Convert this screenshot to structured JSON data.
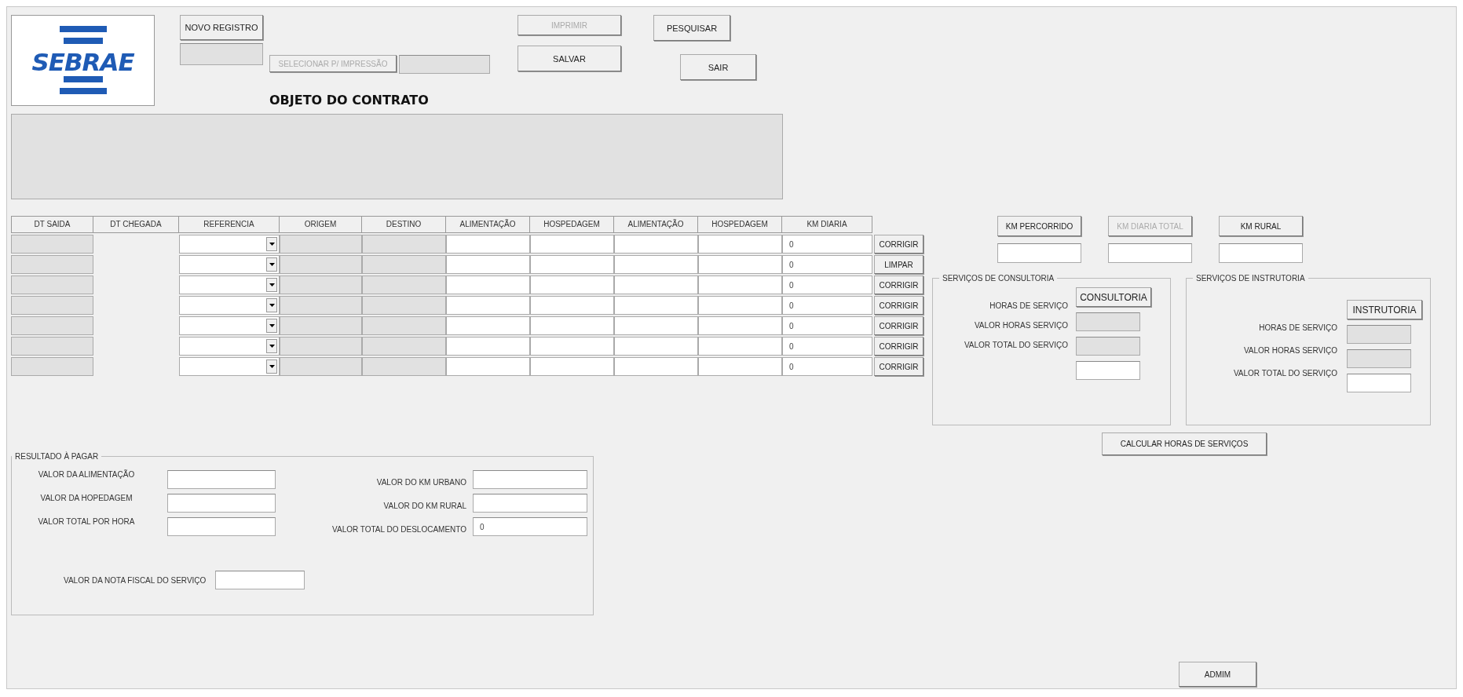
{
  "logo": {
    "text": "SEBRAE"
  },
  "header": {
    "new_record": {
      "label": "NOVO REGISTRO"
    },
    "record_field": {
      "disabled": true
    },
    "select_print": {
      "label": "SELECIONAR P/ IMPRESSÃO",
      "disabled": true
    },
    "select_print_field": {
      "disabled": true
    },
    "title": "OBJETO DO CONTRATO",
    "print": {
      "label": "IMPRIMIR",
      "disabled": true
    },
    "save": {
      "label": "SALVAR",
      "disabled": false
    },
    "search": {
      "label": "PESQUISAR",
      "disabled": false
    },
    "exit": {
      "label": "SAIR",
      "disabled": false
    }
  },
  "contract_object": {
    "disabled": true
  },
  "table": {
    "columns": [
      {
        "label": "DT SAIDA",
        "kind": "locked"
      },
      {
        "label": "DT CHEGADA",
        "kind": "none"
      },
      {
        "label": "REFERENCIA",
        "kind": "select"
      },
      {
        "label": "ORIGEM",
        "kind": "locked"
      },
      {
        "label": "DESTINO",
        "kind": "locked"
      },
      {
        "label": "ALIMENTAÇÃO",
        "kind": "input"
      },
      {
        "label": "HOSPEDAGEM",
        "kind": "input"
      },
      {
        "label": "ALIMENTAÇÃO",
        "kind": "input"
      },
      {
        "label": "HOSPEDAGEM",
        "kind": "input"
      },
      {
        "label": "KM DIARIA",
        "kind": "value"
      }
    ],
    "rows": [
      {
        "km_diaria": "0",
        "action": "CORRIGIR"
      },
      {
        "km_diaria": "0",
        "action": "LIMPAR"
      },
      {
        "km_diaria": "0",
        "action": "CORRIGIR"
      },
      {
        "km_diaria": "0",
        "action": "CORRIGIR"
      },
      {
        "km_diaria": "0",
        "action": "CORRIGIR"
      },
      {
        "km_diaria": "0",
        "action": "CORRIGIR"
      },
      {
        "km_diaria": "0",
        "action": "CORRIGIR"
      }
    ]
  },
  "km_totals": [
    {
      "label": "KM PERCORRIDO",
      "disabled": false
    },
    {
      "label": "KM DIARIA TOTAL",
      "disabled": true
    },
    {
      "label": "KM RURAL",
      "disabled": false
    }
  ],
  "service_groups": [
    {
      "title": "SERVIÇOS DE CONSULTORIA",
      "button": "CONSULTORIA",
      "labels": [
        "HORAS DE SERVIÇO",
        "VALOR  HORAS SERVIÇO",
        "VALOR TOTAL DO SERVIÇO"
      ],
      "fields": [
        {
          "disabled": true
        },
        {
          "disabled": true
        },
        {
          "disabled": false
        }
      ]
    },
    {
      "title": "SERVIÇOS DE INSTRUTORIA",
      "button": "INSTRUTORIA",
      "labels": [
        "HORAS DE SERVIÇO",
        "VALOR  HORAS SERVIÇO",
        "VALOR TOTAL DO SERVIÇO"
      ],
      "fields": [
        {
          "disabled": true
        },
        {
          "disabled": true
        },
        {
          "disabled": false
        }
      ]
    }
  ],
  "calculate_button": "CALCULAR HORAS DE SERVIÇOS",
  "result": {
    "title": "RESULTADO À PAGAR",
    "left": [
      {
        "label": "VALOR DA ALIMENTAÇÃO"
      },
      {
        "label": "VALOR DA HOPEDAGEM"
      },
      {
        "label": "VALOR TOTAL POR HORA"
      }
    ],
    "right": [
      {
        "label": "VALOR DO KM URBANO"
      },
      {
        "label": "VALOR DO KM RURAL"
      },
      {
        "label": "VALOR TOTAL DO DESLOCAMENTO",
        "value": "0"
      }
    ],
    "invoice": {
      "label": "VALOR DA NOTA FISCAL DO SERVIÇO"
    }
  },
  "admin_button": "ADMIM"
}
